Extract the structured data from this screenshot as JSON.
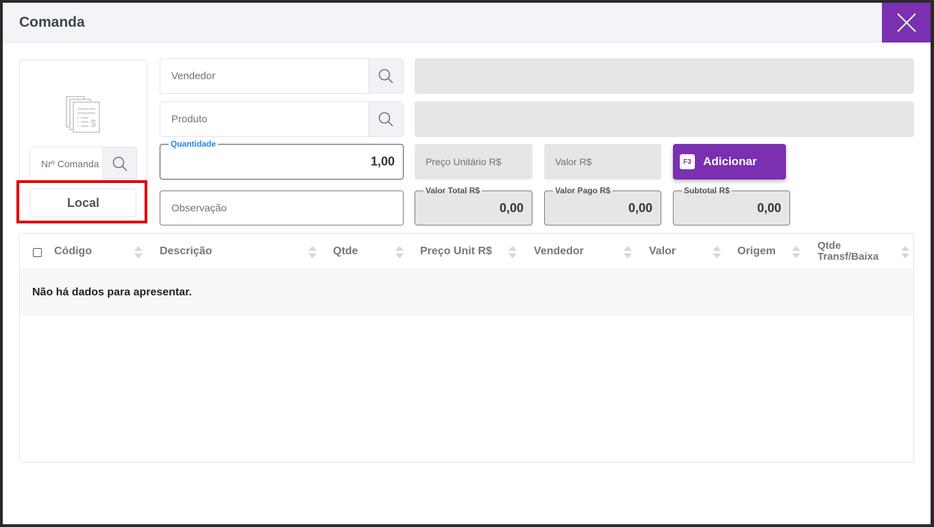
{
  "modal": {
    "title": "Comanda"
  },
  "comanda": {
    "label": "Nrº Comanda",
    "local_label": "Local"
  },
  "fields": {
    "vendedor": "Vendedor",
    "produto": "Produto",
    "observacao": "Observação",
    "quantidade_label": "Quantidade",
    "quantidade_value": "1,00",
    "preco_unitario": "Preço Unitário R$",
    "valor": "Valor R$"
  },
  "totals": {
    "valor_total_label": "Valor Total R$",
    "valor_total_value": "0,00",
    "valor_pago_label": "Valor Pago R$",
    "valor_pago_value": "0,00",
    "subtotal_label": "Subtotal R$",
    "subtotal_value": "0,00"
  },
  "add_button": {
    "shortcut": "F3",
    "label": "Adicionar"
  },
  "table": {
    "columns": [
      "Código",
      "Descrição",
      "Qtde",
      "Preço Unit R$",
      "Vendedor",
      "Valor",
      "Origem",
      "Qtde Transf/Baixa"
    ],
    "empty_message": "Não há dados para apresentar."
  },
  "colors": {
    "accent": "#7b2fb1",
    "highlight": "#e00000",
    "focus_label": "#1e88e5"
  },
  "icons": {
    "close": "close-icon",
    "search": "search-icon",
    "document": "document-list-icon",
    "sort": "sort-icon"
  }
}
